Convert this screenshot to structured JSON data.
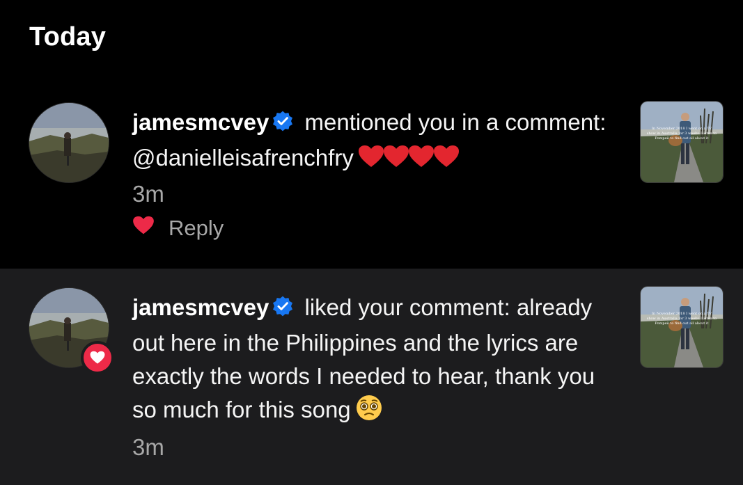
{
  "section": {
    "title": "Today"
  },
  "notifications": [
    {
      "username": "jamesmcvey",
      "action_text": "mentioned you in a comment: @danielleisafrenchfry",
      "timestamp": "3m",
      "reply_label": "Reply",
      "thumbnail_caption": "In November 2018 I went on a TV show in Australia for 3 weeks. Listen to Pompeii to find out all about it"
    },
    {
      "username": "jamesmcvey",
      "action_text": "liked your comment: already out here in the Philippines and the lyrics are exactly the words I needed to hear, thank you so much for this song",
      "timestamp": "3m",
      "thumbnail_caption": "In November 2018 I went on a TV show in Australia for 3 weeks. Listen to Pompeii to find out all about it"
    }
  ],
  "colors": {
    "background": "#000000",
    "highlight_row": "#1c1c1e",
    "verified_blue": "#1877f2",
    "heart_red": "#ed2a48",
    "secondary_text": "#a8a8a8"
  },
  "icons": {
    "verified": "verified-badge-icon",
    "like": "heart-icon",
    "emoji": "pleading-face-emoji"
  }
}
